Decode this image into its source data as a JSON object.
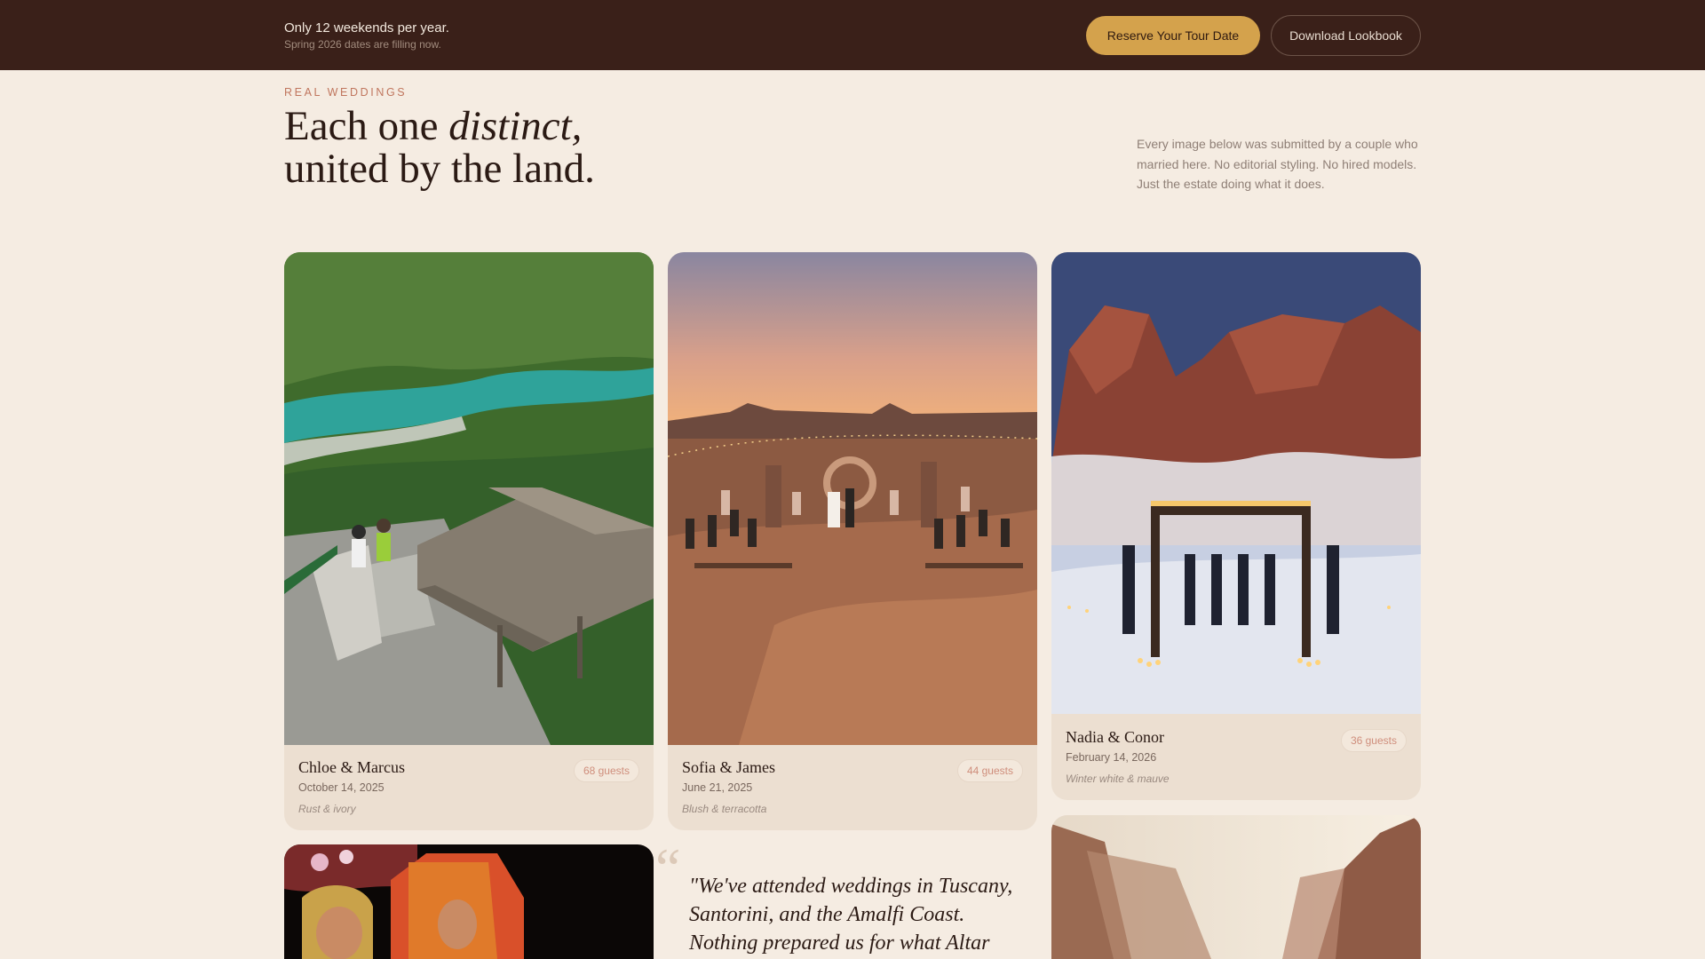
{
  "banner": {
    "title": "Only 12 weekends per year.",
    "subtitle": "Spring 2026 dates are filling now.",
    "reserve_label": "Reserve Your Tour Date",
    "lookbook_label": "Download Lookbook"
  },
  "header": {
    "eyebrow": "REAL WEDDINGS",
    "headline_part1": "Each one ",
    "headline_em": "distinct,",
    "headline_part2": "united by the land.",
    "intro": "Every image below was submitted by a couple who married here. No editorial styling. No hired models. Just the estate doing what it does."
  },
  "weddings": [
    {
      "couple": "Chloe & Marcus",
      "date": "October 14, 2025",
      "palette": "Rust & ivory",
      "guests": "68 guests"
    },
    {
      "couple": "Sofia & James",
      "date": "June 21, 2025",
      "palette": "Blush & terracotta",
      "guests": "44 guests"
    },
    {
      "couple": "Nadia & Conor",
      "date": "February 14, 2026",
      "palette": "Winter white & mauve",
      "guests": "36 guests"
    }
  ],
  "testimonial": {
    "mark": "“",
    "text": "\"We've attended weddings in Tuscany, Santorini, and the Amalfi Coast. Nothing prepared us for what Altar"
  },
  "colors": {
    "banner_bg": "#3a2019",
    "accent": "#d4a24c",
    "page_bg": "#f5ece2",
    "eyebrow": "#c0765e"
  }
}
